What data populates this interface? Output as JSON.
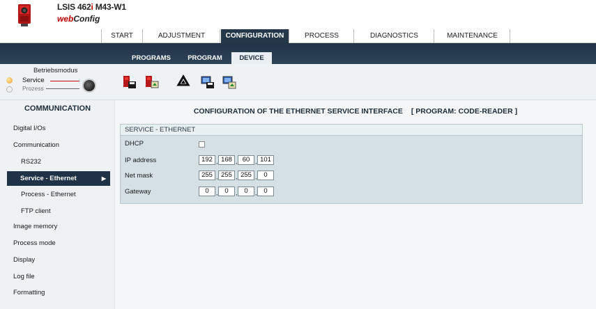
{
  "header": {
    "device_name_left": "LSIS 462",
    "device_name_slash": "i",
    "device_name_right": " M43-W1",
    "subtitle_web": "web",
    "subtitle_config": "Config"
  },
  "topnav": {
    "tabs": [
      "START",
      "ADJUSTMENT",
      "CONFIGURATION",
      "PROCESS",
      "DIAGNOSTICS",
      "MAINTENANCE"
    ],
    "active": "CONFIGURATION"
  },
  "subnav": {
    "tabs": [
      "PROGRAMS",
      "PROGRAM",
      "DEVICE"
    ],
    "active": "DEVICE"
  },
  "mode": {
    "title": "Betriebsmodus",
    "service": "Service",
    "process": "Prozess"
  },
  "toolbar": {
    "icons": [
      "device-save-icon",
      "device-load-icon",
      "recycle-icon",
      "pc-save-icon",
      "pc-load-icon"
    ]
  },
  "sidebar": {
    "heading": "COMMUNICATION",
    "items": [
      {
        "label": "Digital I/Os",
        "level": 1
      },
      {
        "label": "Communication",
        "level": 1
      },
      {
        "label": "RS232",
        "level": 2
      },
      {
        "label": "Service - Ethernet",
        "level": 2,
        "active": true
      },
      {
        "label": "Process - Ethernet",
        "level": 2
      },
      {
        "label": "FTP client",
        "level": 2
      },
      {
        "label": "Image memory",
        "level": 1
      },
      {
        "label": "Process mode",
        "level": 1
      },
      {
        "label": "Display",
        "level": 1
      },
      {
        "label": "Log file",
        "level": 1
      },
      {
        "label": "Formatting",
        "level": 1
      }
    ]
  },
  "main": {
    "title": "CONFIGURATION OF THE ETHERNET SERVICE INTERFACE",
    "program": "[ PROGRAM: CODE-READER ]",
    "panel_title": "SERVICE - ETHERNET",
    "fields": {
      "dhcp_label": "DHCP",
      "dhcp_checked": false,
      "ip_label": "IP address",
      "ip": [
        "192",
        "168",
        "60",
        "101"
      ],
      "mask_label": "Net mask",
      "mask": [
        "255",
        "255",
        "255",
        "0"
      ],
      "gateway_label": "Gateway",
      "gateway": [
        "0",
        "0",
        "0",
        "0"
      ]
    }
  },
  "colors": {
    "nav_dark": "#25384a",
    "accent_red": "#c00000",
    "panel": "#d4e0e4"
  }
}
